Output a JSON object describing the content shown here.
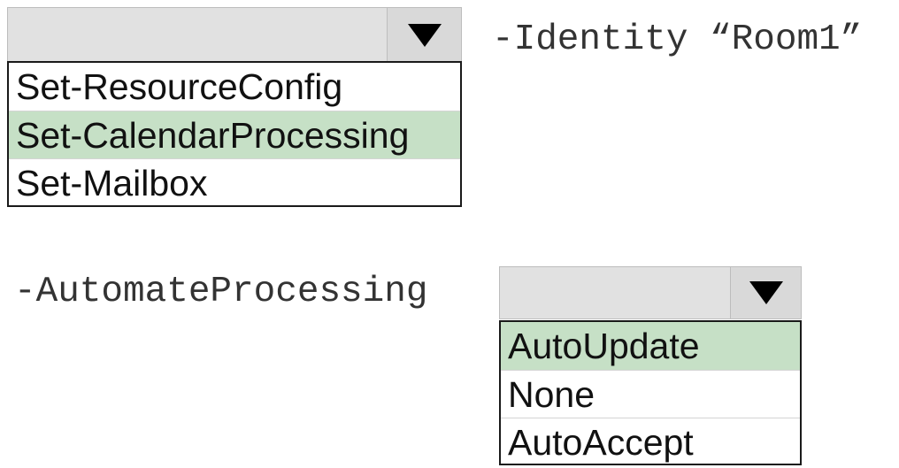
{
  "cmdlet_dropdown": {
    "selected_value": "",
    "options": [
      {
        "label": "Set-ResourceConfig",
        "highlighted": false
      },
      {
        "label": "Set-CalendarProcessing",
        "highlighted": true
      },
      {
        "label": "Set-Mailbox",
        "highlighted": false
      }
    ]
  },
  "identity_parameter": "-Identity “Room1”",
  "automate_parameter": "-AutomateProcessing",
  "automate_dropdown": {
    "selected_value": "",
    "options": [
      {
        "label": "AutoUpdate",
        "highlighted": true
      },
      {
        "label": "None",
        "highlighted": false
      },
      {
        "label": "AutoAccept",
        "highlighted": false
      }
    ]
  },
  "colors": {
    "highlight": "#c6e0c6",
    "dropdown_header": "#e1e1e1",
    "border": "#1a1a1a",
    "caret": "#000000"
  },
  "icons": {
    "dropdown_caret": "caret-down-icon"
  }
}
